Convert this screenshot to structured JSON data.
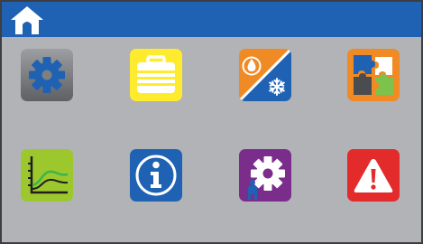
{
  "colors": {
    "topbar": "#1f62b3",
    "background": "#b1b3b6",
    "settings_tile": "#7d7f82",
    "case_tile": "#ffeb2d",
    "heat_tile": "#f08a24",
    "cool_tile": "#1f62b3",
    "puzzle_tile": "#f08a24",
    "graph_tile": "#9dc82d",
    "info_tile": "#1f62b3",
    "service_tile": "#7b2d8c",
    "alarm_tile": "#e32b2b"
  },
  "topbar": {
    "home_icon": "home-icon"
  },
  "tiles": [
    {
      "id": "settings",
      "icon": "gear-icon"
    },
    {
      "id": "case",
      "icon": "suitcase-icon"
    },
    {
      "id": "heat-cool",
      "icon": "flame-snowflake-icon"
    },
    {
      "id": "puzzle",
      "icon": "puzzle-icon"
    },
    {
      "id": "graph",
      "icon": "line-graph-icon"
    },
    {
      "id": "info",
      "icon": "info-icon"
    },
    {
      "id": "service",
      "icon": "service-gear-icon"
    },
    {
      "id": "alarm",
      "icon": "warning-icon"
    }
  ]
}
